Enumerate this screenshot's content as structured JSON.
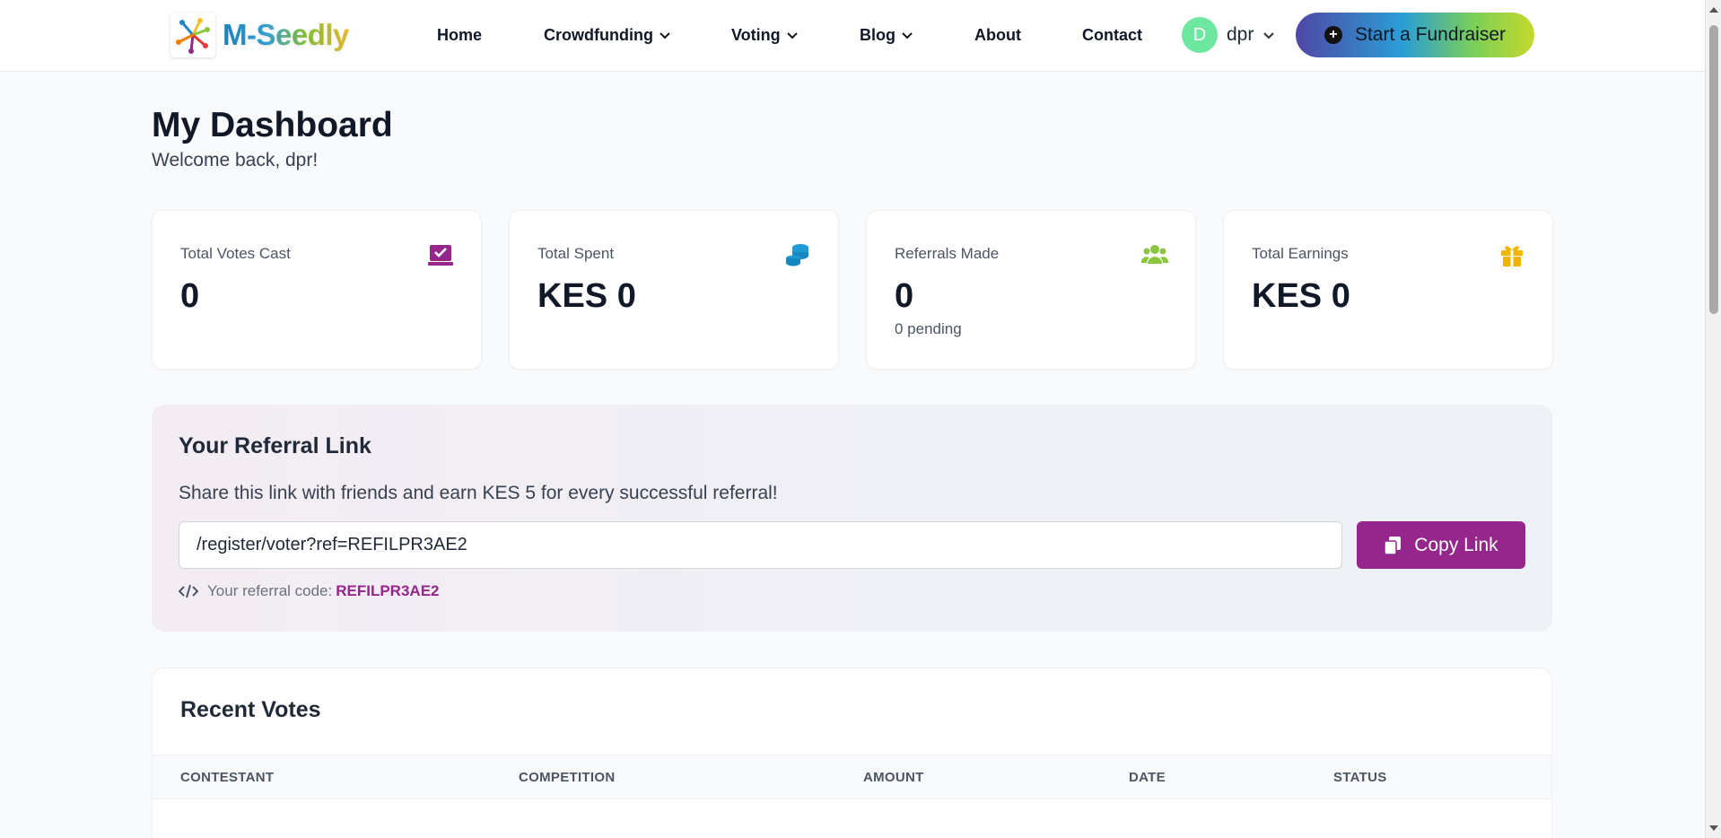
{
  "brand": {
    "name": "M-Seedly"
  },
  "nav": {
    "home": "Home",
    "crowdfunding": "Crowdfunding",
    "voting": "Voting",
    "blog": "Blog",
    "about": "About",
    "contact": "Contact"
  },
  "user": {
    "initial": "D",
    "name": "dpr",
    "avatar_color": "#6ee7a1"
  },
  "cta": {
    "label": "Start a Fundraiser",
    "icon": "plus-circle-icon"
  },
  "header": {
    "title": "My Dashboard",
    "welcome": "Welcome back, dpr!"
  },
  "stats": [
    {
      "label": "Total Votes Cast",
      "value": "0",
      "icon": "vote-check-icon",
      "color": "#95268c"
    },
    {
      "label": "Total Spent",
      "value": "KES 0",
      "icon": "coins-icon",
      "color": "#1d9bd6"
    },
    {
      "label": "Referrals Made",
      "value": "0",
      "sub": "0 pending",
      "icon": "users-icon",
      "color": "#8cc63f"
    },
    {
      "label": "Total Earnings",
      "value": "KES 0",
      "icon": "gift-icon",
      "color": "#f4b400"
    }
  ],
  "referral": {
    "title": "Your Referral Link",
    "description": "Share this link with friends and earn KES 5 for every successful referral!",
    "link": "/register/voter?ref=REFILPR3AE2",
    "copy_label": "Copy Link",
    "code_prefix": "Your referral code:",
    "code": "REFILPR3AE2",
    "accent": "#95268c"
  },
  "recent_votes": {
    "title": "Recent Votes",
    "columns": [
      "CONTESTANT",
      "COMPETITION",
      "AMOUNT",
      "DATE",
      "STATUS"
    ]
  }
}
